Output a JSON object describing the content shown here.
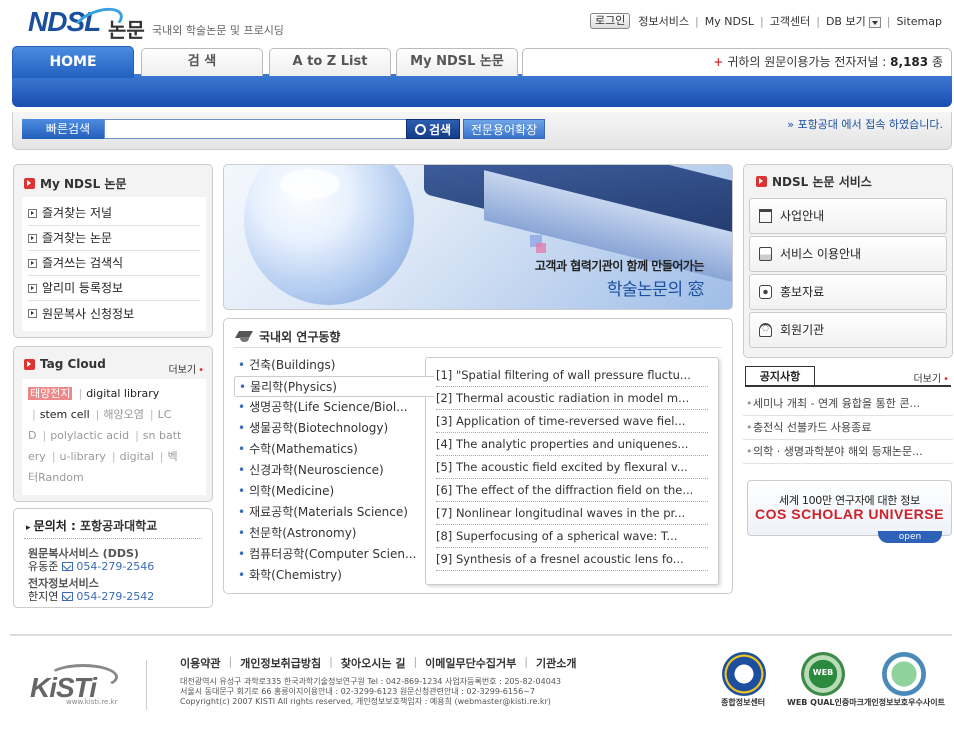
{
  "header": {
    "logo_text": "NDSL",
    "logo_suffix": "논문",
    "tagline": "국내외 학술논문 및 프로시딩",
    "topnav": {
      "login": "로그인",
      "info": "정보서비스",
      "my_ndsl": "My NDSL",
      "customer": "고객센터",
      "db_view": "DB 보기",
      "sitemap": "Sitemap"
    }
  },
  "tabs": [
    {
      "label": "HOME"
    },
    {
      "label": "검  색"
    },
    {
      "label": "A to Z List"
    },
    {
      "label": "My NDSL 논문"
    }
  ],
  "journal_notice": {
    "prefix": "귀하의 원문이용가능 전자저널 : ",
    "count": "8,183",
    "suffix": " 종"
  },
  "quick_search": {
    "label": "빠른검색",
    "value": "",
    "search_button": "검색",
    "expand_button": "전문용어확장",
    "access_note": "» 포항공대 에서 접속 하였습니다."
  },
  "my_ndsl": {
    "title": "My NDSL 논문",
    "items": [
      "즐겨찾는 저널",
      "즐겨찾는 논문",
      "즐겨쓰는 검색식",
      "알리미 등록정보",
      "원문복사 신청정보"
    ]
  },
  "tag_cloud": {
    "title": "Tag Cloud",
    "more": "더보기",
    "tags": [
      "태양전지",
      "digital library",
      "stem cell",
      "해양오염",
      "LC",
      "D",
      "polylactic acid",
      "sn batt",
      "ery",
      "u-library",
      "digital",
      "벡",
      "터Random"
    ]
  },
  "contact": {
    "title_prefix": "문의처 : ",
    "title_org": "포항공과대학교",
    "dds_title": "원문복사서비스 (DDS)",
    "dds_person": "유동준",
    "dds_phone": "054-279-2546",
    "ej_title": "전자정보서비스",
    "ej_person": "한지연",
    "ej_phone": "054-279-2542"
  },
  "banner": {
    "line1": "고객과 협력기관이 함께 만들어가는",
    "line2": "학술논문의 窓"
  },
  "research": {
    "title": "국내외 연구동향",
    "fields": [
      "건축(Buildings)",
      "물리학(Physics)",
      "생명공학(Life Science/Biol...",
      "생물공학(Biotechnology)",
      "수학(Mathematics)",
      "신경과학(Neuroscience)",
      "의학(Medicine)",
      "재료공학(Materials Science)",
      "천문학(Astronomy)",
      "컴퓨터공학(Computer Scien...",
      "화학(Chemistry)"
    ],
    "active_index": 1,
    "papers": [
      "[1] \"Spatial filtering of wall pressure fluctu...",
      "[2] Thermal acoustic radiation in model m...",
      "[3] Application of time-reversed wave fiel...",
      "[4] The analytic properties and uniquenes...",
      "[5] The acoustic field excited by flexural v...",
      "[6] The effect of the diffraction field on the...",
      "[7] Nonlinear longitudinal waves in the pr...",
      "[8] Superfocusing of a spherical wave: T...",
      "[9] Synthesis of a fresnel acoustic lens fo..."
    ]
  },
  "services": {
    "title": "NDSL 논문 서비스",
    "items": [
      {
        "label": "사업안내",
        "icon": "building-icon"
      },
      {
        "label": "서비스 이용안내",
        "icon": "document-icon"
      },
      {
        "label": "홍보자료",
        "icon": "brochure-icon"
      },
      {
        "label": "회원기관",
        "icon": "member-icon"
      }
    ]
  },
  "notices": {
    "title": "공지사항",
    "more": "더보기",
    "items": [
      "세미나 개최 - 연계 융합을 통한 콘...",
      "충전식 선불카드 사용종료",
      "의학 · 생명과학분야 해외 등재논문..."
    ]
  },
  "cos": {
    "line1": "세계 100만 연구자에 대한 정보",
    "line2": "COS SCHOLAR UNIVERSE",
    "open": "open"
  },
  "footer": {
    "links": [
      "이용약관",
      "개인정보취급방침",
      "찾아오시는 길",
      "이메일무단수집거부",
      "기관소개"
    ],
    "address1": "대전광역시 유성구 과학로335 한국과학기술정보연구원 Tel : 042-869-1234 사업자등록번호 : 205-82-04043",
    "address2": "서울시 동대문구 회기로 66 홍릉이지이용안내 : 02-3299-6123 원문신청관련안내 : 02-3299-6156~7",
    "copyright": "Copyright(c) 2007 KISTI All rights reserved, 개인정보보호책임자 : 예용희 (webmaster@kisti.re.kr)",
    "kisti": "KiSTi",
    "kisti_url": "www.kisti.re.kr",
    "certs": [
      "종합정보센터",
      "WEB QUAL인증마크",
      "개인정보보호우수사이트"
    ]
  }
}
